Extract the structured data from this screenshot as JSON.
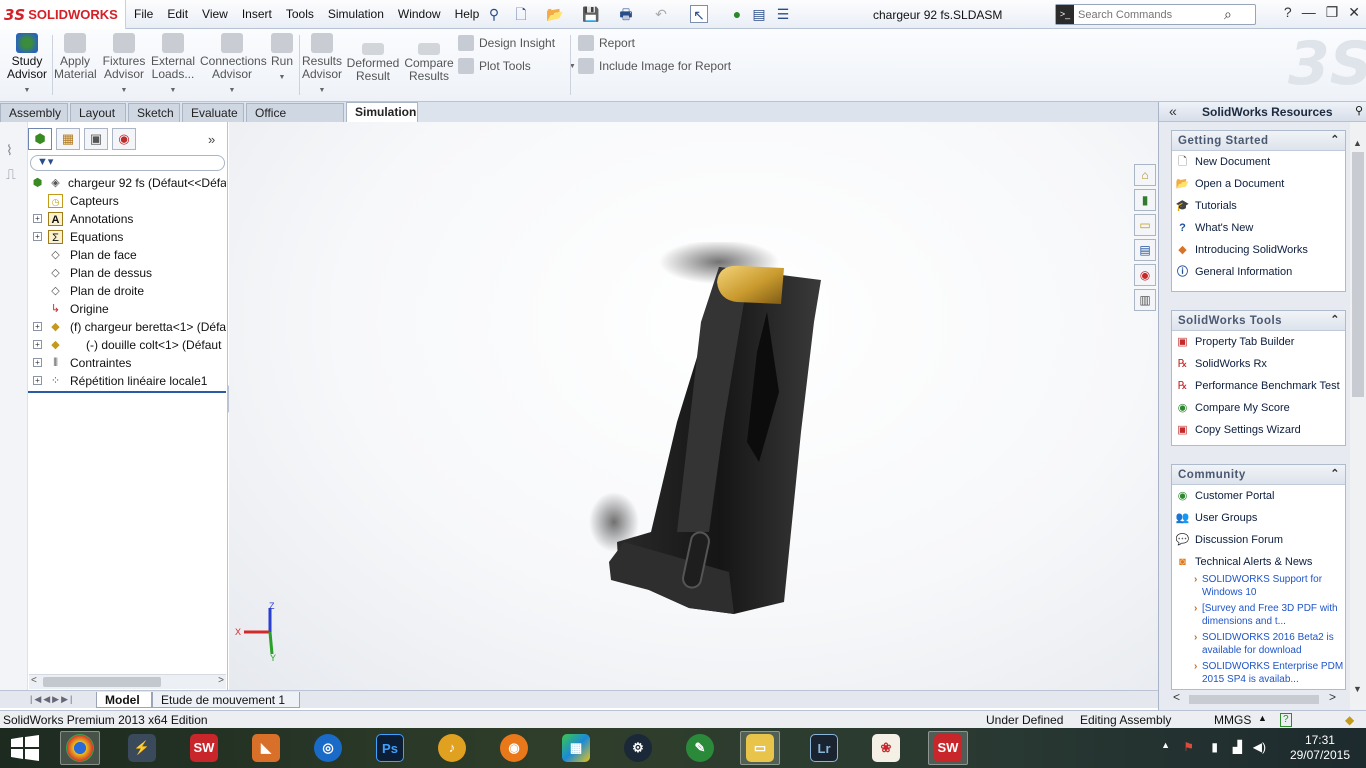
{
  "app": {
    "brand": "SOLIDWORKS",
    "document_title": "chargeur 92 fs.SLDASM"
  },
  "menu": [
    "File",
    "Edit",
    "View",
    "Insert",
    "Tools",
    "Simulation",
    "Window",
    "Help"
  ],
  "search": {
    "placeholder": "Search Commands"
  },
  "ribbon": {
    "study_advisor": "Study Advisor",
    "apply_material": "Apply Material",
    "fixtures_advisor": "Fixtures Advisor",
    "external_loads": "External Loads...",
    "connections_advisor": "Connections Advisor",
    "run": "Run",
    "results_advisor": "Results Advisor",
    "deformed_result": "Deformed Result",
    "compare_results": "Compare Results",
    "design_insight": "Design Insight",
    "plot_tools": "Plot Tools",
    "report": "Report",
    "include_image": "Include Image for Report"
  },
  "tabs": [
    "Assembly",
    "Layout",
    "Sketch",
    "Evaluate",
    "Office Products",
    "Simulation"
  ],
  "active_tab": "Simulation",
  "tree": {
    "root": "chargeur 92 fs  (Défaut<<Défa",
    "items": [
      {
        "label": "Capteurs",
        "icon": "sensor-icon",
        "expandable": false
      },
      {
        "label": "Annotations",
        "icon": "annotation-icon",
        "expandable": true
      },
      {
        "label": "Equations",
        "icon": "equation-icon",
        "expandable": true
      },
      {
        "label": "Plan de face",
        "icon": "plane-icon",
        "expandable": false
      },
      {
        "label": "Plan de dessus",
        "icon": "plane-icon",
        "expandable": false
      },
      {
        "label": "Plan de droite",
        "icon": "plane-icon",
        "expandable": false
      },
      {
        "label": "Origine",
        "icon": "origin-icon",
        "expandable": false
      },
      {
        "label": "(f) chargeur beretta<1> (Défa",
        "icon": "part-icon",
        "expandable": true
      },
      {
        "label": "(-) douille colt<1> (Défaut",
        "icon": "part-icon",
        "expandable": true
      },
      {
        "label": "Contraintes",
        "icon": "mates-icon",
        "expandable": true
      },
      {
        "label": "Répétition linéaire locale1",
        "icon": "pattern-icon",
        "expandable": true
      }
    ]
  },
  "bottom_tabs": [
    "Model",
    "Etude de mouvement 1"
  ],
  "task_pane": {
    "title": "SolidWorks Resources",
    "getting_started": {
      "title": "Getting Started",
      "items": [
        "New Document",
        "Open a Document",
        "Tutorials",
        "What's New",
        "Introducing SolidWorks",
        "General Information"
      ]
    },
    "tools": {
      "title": "SolidWorks Tools",
      "items": [
        "Property Tab Builder",
        "SolidWorks Rx",
        "Performance Benchmark Test",
        "Compare My Score",
        "Copy Settings Wizard"
      ]
    },
    "community": {
      "title": "Community",
      "items": [
        "Customer Portal",
        "User Groups",
        "Discussion Forum",
        "Technical Alerts & News"
      ],
      "news": [
        "SOLIDWORKS Support for Windows 10",
        "[Survey and Free 3D PDF with dimensions and t...",
        "SOLIDWORKS 2016 Beta2 is available for download",
        "SOLIDWORKS Enterprise PDM 2015 SP4 is availab..."
      ]
    }
  },
  "status": {
    "edition": "SolidWorks Premium 2013 x64 Edition",
    "defined": "Under Defined",
    "mode": "Editing Assembly",
    "units": "MMGS"
  },
  "taskbar": {
    "time": "17:31",
    "date": "29/07/2015"
  },
  "colors": {
    "brand_red": "#d42027",
    "accent_blue": "#2a5ba8",
    "link_blue": "#1f55c8"
  }
}
